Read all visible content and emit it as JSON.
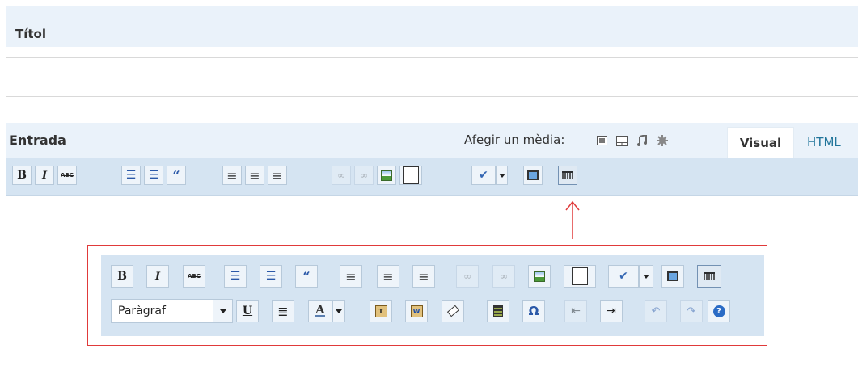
{
  "title_section": {
    "label": "Títol",
    "value": ""
  },
  "entry_section": {
    "label": "Entrada",
    "add_media_label": "Afegir un mèdia:",
    "media_icons": [
      "add-image-icon",
      "add-video-icon",
      "add-audio-icon",
      "add-media-icon"
    ],
    "tabs": {
      "visual": "Visual",
      "html": "HTML"
    },
    "active_tab": "Visual"
  },
  "toolbar_main": {
    "buttons": [
      {
        "name": "bold-button",
        "glyph": "B"
      },
      {
        "name": "italic-button",
        "glyph": "I"
      },
      {
        "name": "strikethrough-button",
        "glyph": "ABC"
      },
      {
        "name": "bullet-list-button",
        "glyph": "☰"
      },
      {
        "name": "numbered-list-button",
        "glyph": "☰"
      },
      {
        "name": "blockquote-button",
        "glyph": "“"
      },
      {
        "name": "align-left-button",
        "glyph": "≡"
      },
      {
        "name": "align-center-button",
        "glyph": "≡"
      },
      {
        "name": "align-right-button",
        "glyph": "≡"
      },
      {
        "name": "insert-link-button",
        "glyph": "∞"
      },
      {
        "name": "remove-link-button",
        "glyph": "∞"
      },
      {
        "name": "insert-image-button",
        "glyph": ""
      },
      {
        "name": "insert-more-button",
        "glyph": ""
      },
      {
        "name": "spellcheck-button",
        "glyph": "✔"
      },
      {
        "name": "fullscreen-button",
        "glyph": ""
      },
      {
        "name": "kitchen-sink-button",
        "glyph": ""
      }
    ]
  },
  "toolbar_kitchen": {
    "format_select_value": "Paràgraf",
    "buttons": [
      {
        "name": "underline-button",
        "glyph": "U"
      },
      {
        "name": "justify-button",
        "glyph": "≣"
      },
      {
        "name": "text-color-button",
        "glyph": "A"
      },
      {
        "name": "paste-text-button",
        "glyph": "T"
      },
      {
        "name": "paste-word-button",
        "glyph": "W"
      },
      {
        "name": "remove-format-button",
        "glyph": ""
      },
      {
        "name": "insert-media-button",
        "glyph": ""
      },
      {
        "name": "special-char-button",
        "glyph": "Ω"
      },
      {
        "name": "outdent-button",
        "glyph": "⇤"
      },
      {
        "name": "indent-button",
        "glyph": "⇥"
      },
      {
        "name": "undo-button",
        "glyph": "↶"
      },
      {
        "name": "redo-button",
        "glyph": "↷"
      },
      {
        "name": "help-button",
        "glyph": "?"
      }
    ]
  },
  "colors": {
    "header_bg": "#eaf2fa",
    "toolbar_bg": "#d5e4f2",
    "highlight_red": "#e03a3a",
    "link_blue": "#21759b"
  }
}
